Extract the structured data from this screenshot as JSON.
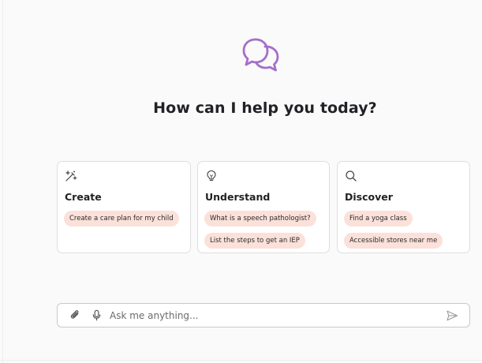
{
  "header": {
    "logo_icon": "chat-bubbles-icon",
    "headline": "How can I help you today?"
  },
  "colors": {
    "accent": "#a46fc9",
    "chip_background": "#fbe1d9",
    "card_border": "#dedede"
  },
  "cards": [
    {
      "icon": "magic-wand-icon",
      "title": "Create",
      "suggestions": [
        "Create a care plan for my child"
      ]
    },
    {
      "icon": "lightbulb-icon",
      "title": "Understand",
      "suggestions": [
        "What is a speech pathologist?",
        "List the steps to get an IEP"
      ]
    },
    {
      "icon": "search-icon",
      "title": "Discover",
      "suggestions": [
        "Find a yoga class",
        "Accessible stores near me"
      ]
    }
  ],
  "composer": {
    "placeholder": "Ask me anything...",
    "value": "",
    "attach_icon": "paperclip-icon",
    "mic_icon": "microphone-icon",
    "send_icon": "send-icon"
  }
}
